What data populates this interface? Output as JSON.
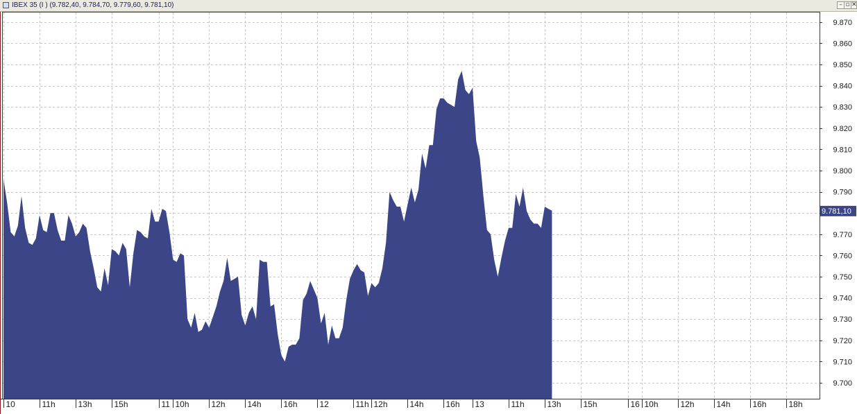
{
  "window": {
    "title": "IBEX 35 (I ) (9.782,40, 9.784,70, 9.779,60, 9.781,10)",
    "minimize_label": "–",
    "restore_label": "▫",
    "close_label": "✕"
  },
  "colors": {
    "area_fill": "#3b4588",
    "grid": "#c8c8c8",
    "frame": "#8b1a1a",
    "last_value_bg": "#3b4588"
  },
  "chart_data": {
    "type": "area",
    "ylim": [
      9692.5,
      9874.5
    ],
    "y_ticks": [
      {
        "value": 9870,
        "label": "9.870"
      },
      {
        "value": 9860,
        "label": "9.860"
      },
      {
        "value": 9850,
        "label": "9.850"
      },
      {
        "value": 9840,
        "label": "9.840"
      },
      {
        "value": 9830,
        "label": "9.830"
      },
      {
        "value": 9820,
        "label": "9.820"
      },
      {
        "value": 9810,
        "label": "9.810"
      },
      {
        "value": 9800,
        "label": "9.800"
      },
      {
        "value": 9790,
        "label": "9.790"
      },
      {
        "value": 9780,
        "label": "9.780"
      },
      {
        "value": 9770,
        "label": "9.770"
      },
      {
        "value": 9760,
        "label": "9.760"
      },
      {
        "value": 9750,
        "label": "9.750"
      },
      {
        "value": 9740,
        "label": "9.740"
      },
      {
        "value": 9730,
        "label": "9.730"
      },
      {
        "value": 9720,
        "label": "9.720"
      },
      {
        "value": 9710,
        "label": "9.710"
      },
      {
        "value": 9700,
        "label": "9.700"
      }
    ],
    "x_ticks": [
      {
        "index": 0,
        "label": "10"
      },
      {
        "index": 10,
        "label": "11h"
      },
      {
        "index": 20,
        "label": "13h"
      },
      {
        "index": 30,
        "label": "15h"
      },
      {
        "index": 43,
        "label": "11"
      },
      {
        "index": 47,
        "label": "10h"
      },
      {
        "index": 57,
        "label": "12h"
      },
      {
        "index": 67,
        "label": "14h"
      },
      {
        "index": 77,
        "label": "16h"
      },
      {
        "index": 87,
        "label": "12"
      },
      {
        "index": 97,
        "label": "11h"
      },
      {
        "index": 102,
        "label": "12h"
      },
      {
        "index": 112,
        "label": "14h"
      },
      {
        "index": 122,
        "label": "16h"
      },
      {
        "index": 130,
        "label": "13"
      },
      {
        "index": 140,
        "label": "11h"
      },
      {
        "index": 150,
        "label": "13h"
      },
      {
        "index": 160,
        "label": "15h"
      },
      {
        "index": 173,
        "label": "16"
      },
      {
        "index": 177,
        "label": "10h"
      },
      {
        "index": 187,
        "label": "12h"
      },
      {
        "index": 197,
        "label": "14h"
      },
      {
        "index": 207,
        "label": "16h"
      },
      {
        "index": 217,
        "label": "18h"
      }
    ],
    "series": [
      {
        "values": [
          9796,
          9785,
          9771,
          9769,
          9774,
          9788,
          9773,
          9766,
          9765,
          9768,
          9779,
          9772,
          9771,
          9780,
          9780,
          9772,
          9767,
          9767,
          9779,
          9775,
          9769,
          9771,
          9775,
          9773,
          9762,
          9754,
          9745,
          9743,
          9754,
          9746,
          9763,
          9762,
          9760,
          9766,
          9763,
          9745,
          9761,
          9772,
          9771,
          9769,
          9768,
          9782,
          9776,
          9776,
          9782,
          9781,
          9771,
          9758,
          9757,
          9761,
          9760,
          9730,
          9726,
          9733,
          9724,
          9725,
          9729,
          9726,
          9731,
          9736,
          9743,
          9748,
          9759,
          9748,
          9749,
          9750,
          9732,
          9727,
          9733,
          9736,
          9730,
          9758,
          9757,
          9757,
          9736,
          9737,
          9723,
          9713,
          9710,
          9717,
          9718,
          9718,
          9721,
          9739,
          9742,
          9748,
          9744,
          9740,
          9728,
          9733,
          9718,
          9727,
          9721,
          9721,
          9726,
          9739,
          9749,
          9753,
          9756,
          9753,
          9752,
          9741,
          9747,
          9745,
          9747,
          9754,
          9766,
          9790,
          9786,
          9783,
          9783,
          9776,
          9784,
          9792,
          9785,
          9791,
          9808,
          9801,
          9812,
          9812,
          9829,
          9834,
          9834,
          9832,
          9831,
          9830,
          9843,
          9847,
          9838,
          9836,
          9839,
          9814,
          9806,
          9788,
          9772,
          9770,
          9758,
          9750,
          9759,
          9767,
          9773,
          9773,
          9789,
          9783,
          9792,
          9781,
          9777,
          9775,
          9775,
          9773,
          9783,
          9782,
          9781.1
        ]
      }
    ],
    "last_value": 9781.1,
    "last_value_label": "9.781,10",
    "grid": true
  }
}
